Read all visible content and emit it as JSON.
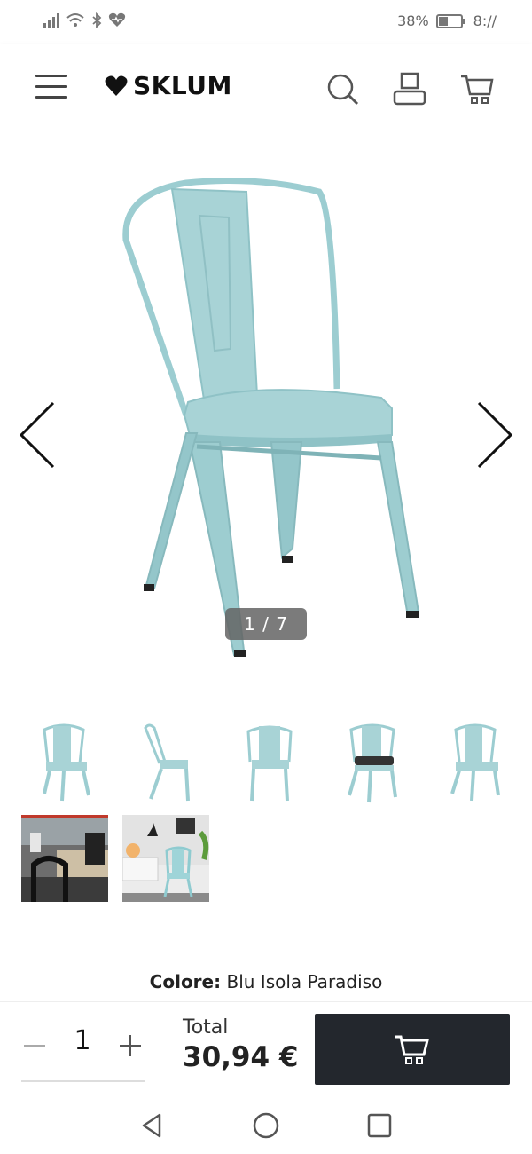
{
  "status_bar": {
    "battery": "38%",
    "time": "8://",
    "icons": [
      "signal-icon",
      "wifi-icon",
      "bluetooth-icon",
      "health-heart-icon",
      "battery-icon"
    ]
  },
  "header": {
    "brand": "SKLUM",
    "icons": [
      "menu-icon",
      "heart-logo-icon",
      "search-icon",
      "user-icon",
      "cart-icon"
    ]
  },
  "gallery": {
    "counter": "1 / 7",
    "accent_color": "#a8d3d6",
    "thumbnails": [
      "thumb-chair-front",
      "thumb-chair-side",
      "thumb-chair-back",
      "thumb-chair-cushion",
      "thumb-chair-angle",
      "thumb-restaurant-scene",
      "thumb-room-scene"
    ]
  },
  "product": {
    "color_label": "Colore:",
    "color_value": "Blu Isola Paradiso"
  },
  "purchase": {
    "quantity": "1",
    "total_label": "Total",
    "total_value": "30,94 €"
  },
  "colors": {
    "cart_button": "#23272d",
    "chair": "#a8d3d6"
  }
}
